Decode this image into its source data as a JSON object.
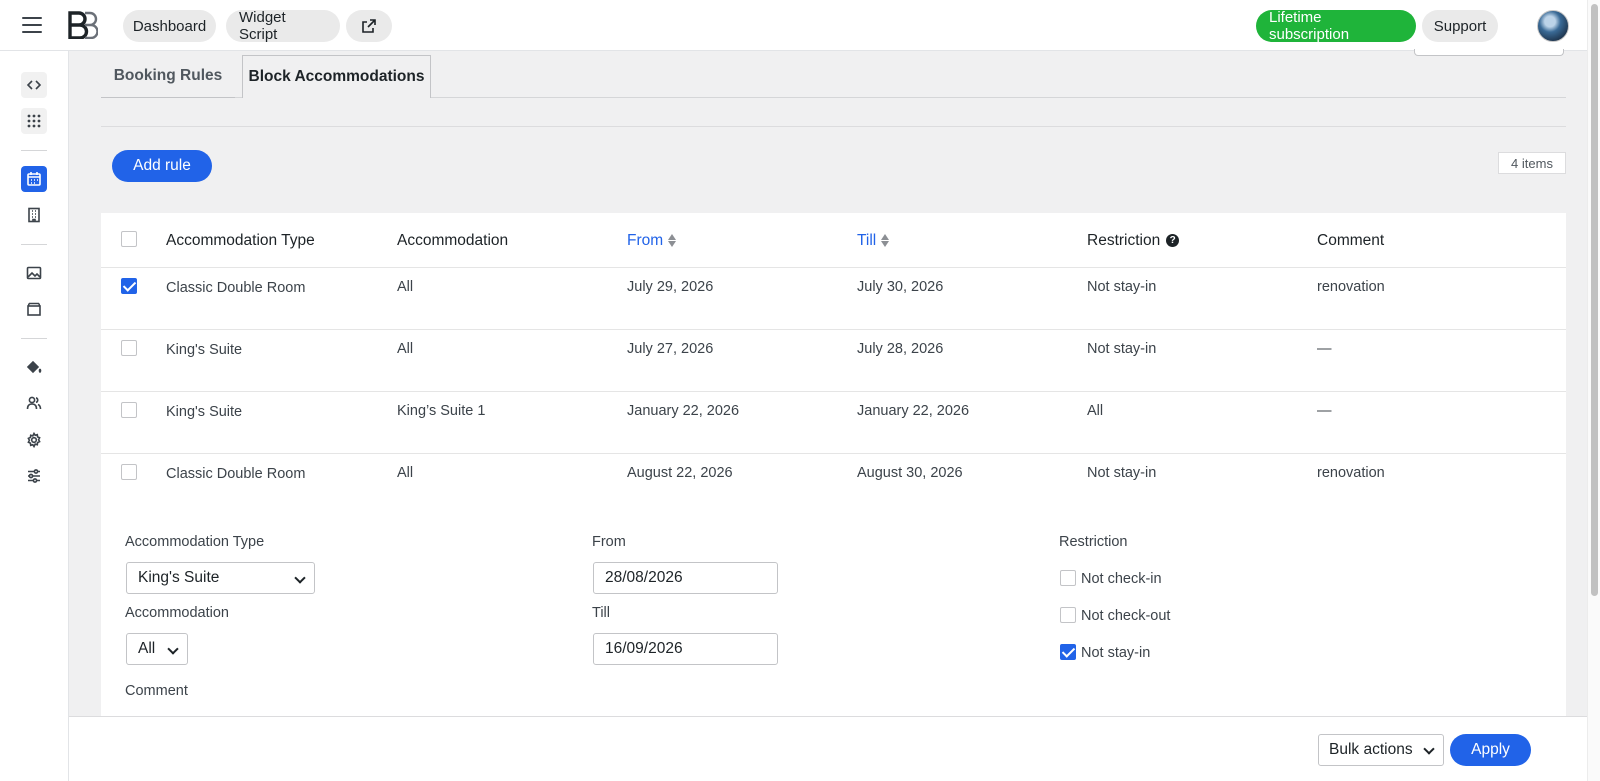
{
  "topbar": {
    "nav": [
      "Dashboard",
      "Widget Script"
    ],
    "external_icon": "external-link-icon",
    "subscription_label": "Lifetime subscription",
    "support_label": "Support"
  },
  "tabs": [
    {
      "label": "Booking Rules",
      "active": false
    },
    {
      "label": "Block Accommodations",
      "active": true
    }
  ],
  "toolbar": {
    "add_rule_label": "Add rule",
    "items_count": "4 items"
  },
  "table": {
    "headers": {
      "accommodation_type": "Accommodation Type",
      "accommodation": "Accommodation",
      "from": "From",
      "till": "Till",
      "restriction": "Restriction",
      "comment": "Comment"
    },
    "help_glyph": "?",
    "rows": [
      {
        "checked": true,
        "type": "Classic Double Room",
        "accommodation": "All",
        "from": "July 29, 2026",
        "till": "July 30, 2026",
        "restriction": "Not stay-in",
        "comment": "renovation"
      },
      {
        "checked": false,
        "type": "King's Suite",
        "accommodation": "All",
        "from": "July 27, 2026",
        "till": "July 28, 2026",
        "restriction": "Not stay-in",
        "comment": "—"
      },
      {
        "checked": false,
        "type": "King's Suite",
        "accommodation": "King’s Suite 1",
        "from": "January 22, 2026",
        "till": "January 22, 2026",
        "restriction": "All",
        "comment": "—"
      },
      {
        "checked": false,
        "type": "Classic Double Room",
        "accommodation": "All",
        "from": "August 22, 2026",
        "till": "August 30, 2026",
        "restriction": "Not stay-in",
        "comment": "renovation"
      }
    ]
  },
  "form": {
    "accommodation_type_label": "Accommodation Type",
    "accommodation_type_value": "King's Suite",
    "accommodation_label": "Accommodation",
    "accommodation_value": "All",
    "comment_label": "Comment",
    "from_label": "From",
    "from_value": "28/08/2026",
    "till_label": "Till",
    "till_value": "16/09/2026",
    "restriction_label": "Restriction",
    "restrictions": [
      {
        "label": "Not check-in",
        "checked": false
      },
      {
        "label": "Not check-out",
        "checked": false
      },
      {
        "label": "Not stay-in",
        "checked": true
      }
    ]
  },
  "footer": {
    "bulk_actions_label": "Bulk actions",
    "apply_label": "Apply"
  },
  "colors": {
    "accent": "#2163e8",
    "subscription": "#1fb43a"
  }
}
